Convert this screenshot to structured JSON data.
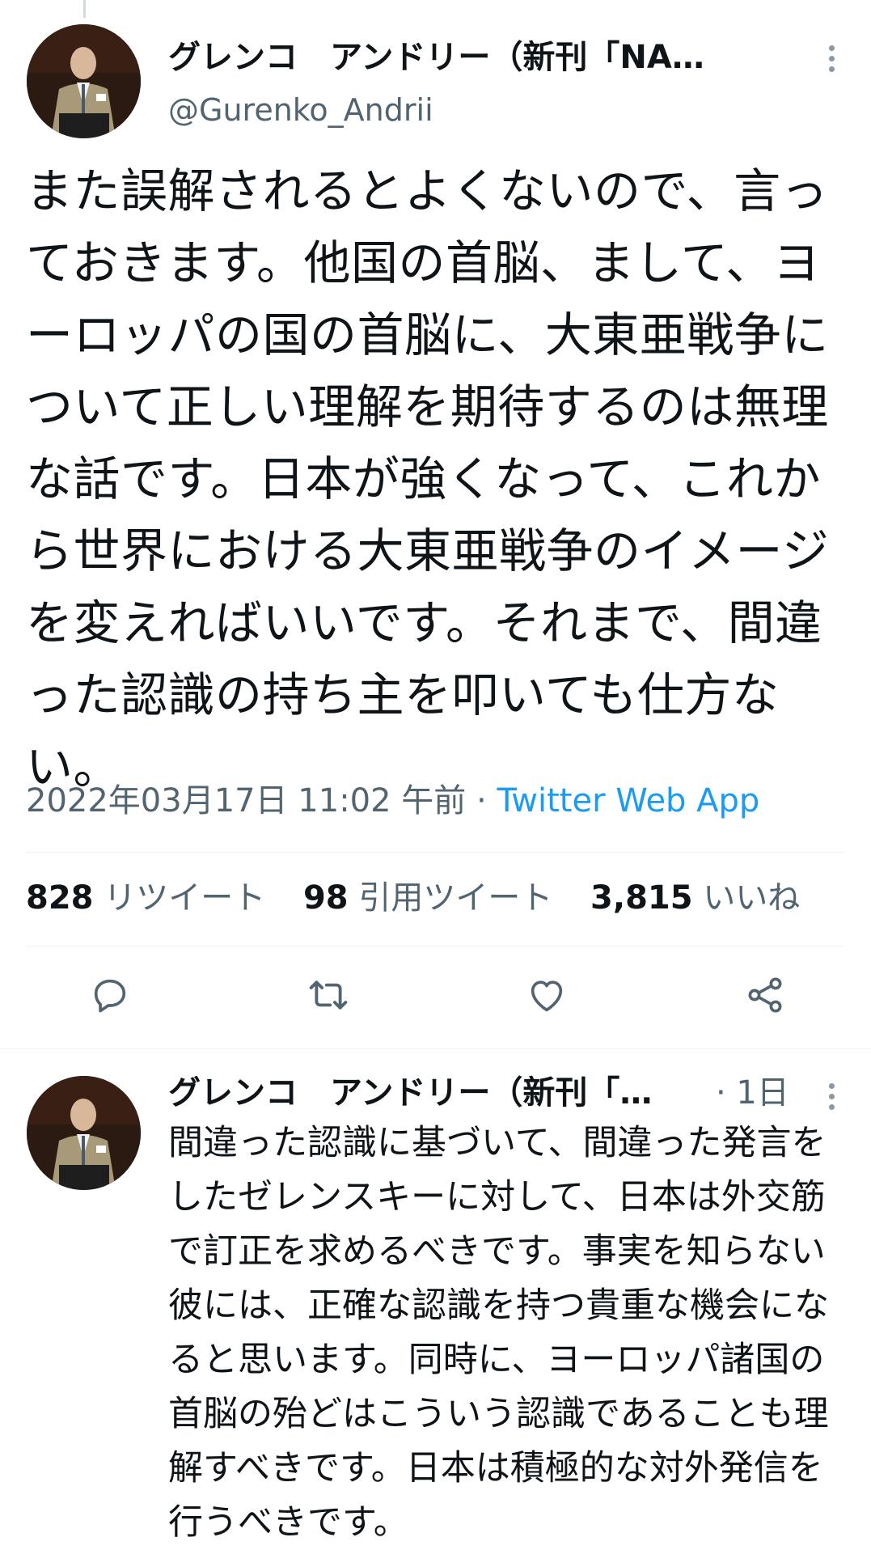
{
  "main_tweet": {
    "display_name": "グレンコ　アンドリー（新刊「NA…",
    "handle": "@Gurenko_Andrii",
    "text": "また誤解されるとよくないので、言っておきます。他国の首脳、まして、ヨーロッパの国の首脳に、大東亜戦争について正しい理解を期待するのは無理な話です。日本が強くなって、これから世界における大東亜戦争のイメージを変えればいいです。それまで、間違った認識の持ち主を叩いても仕方ない。",
    "timestamp": "2022年03月17日 11:02 午前",
    "separator": " · ",
    "source": "Twitter Web App",
    "stats": {
      "retweets_count": "828",
      "retweets_label": "リツイート",
      "quotes_count": "98",
      "quotes_label": "引用ツイート",
      "likes_count": "3,815",
      "likes_label": "いいね"
    }
  },
  "reply_tweet": {
    "display_name": "グレンコ　アンドリー（新刊「…",
    "time": "· 1日",
    "text": "間違った認識に基づいて、間違った発言をしたゼレンスキーに対して、日本は外交筋で訂正を求めるべきです。事実を知らない彼には、正確な認識を持つ貴重な機会になると思います。同時に、ヨーロッパ諸国の首脳の殆どはこういう認識であることも理解すべきです。日本は積極的な対外発信を行うべきです。"
  },
  "icons": {
    "reply": "reply-icon",
    "retweet": "retweet-icon",
    "like": "heart-icon",
    "share": "share-icon",
    "more": "more-vertical-icon"
  },
  "colors": {
    "text_primary": "#0f1419",
    "text_secondary": "#536471",
    "link": "#1d9bf0",
    "divider": "#eff3f4"
  }
}
